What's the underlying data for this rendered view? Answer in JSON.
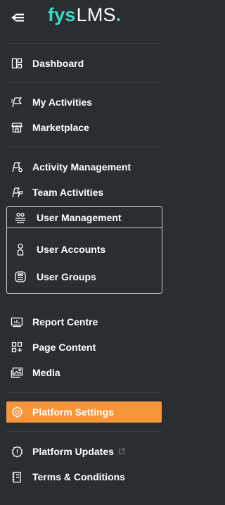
{
  "brand": {
    "part1": "fys",
    "part2": "LMS",
    "dot": "."
  },
  "colors": {
    "background": "#2a2d32",
    "brand_accent": "#3ed8c3",
    "active": "#f7953b",
    "divider": "#3d4148"
  },
  "nav": {
    "dashboard": "Dashboard",
    "my_activities": "My Activities",
    "marketplace": "Marketplace",
    "activity_management": "Activity Management",
    "team_activities": "Team Activities",
    "user_management": "User Management",
    "user_accounts": "User Accounts",
    "user_groups": "User Groups",
    "report_centre": "Report Centre",
    "page_content": "Page Content",
    "media": "Media",
    "platform_settings": "Platform Settings",
    "platform_updates": "Platform Updates",
    "terms": "Terms & Conditions"
  },
  "icons": {
    "collapse": "collapse-menu-icon",
    "dashboard": "dashboard-icon",
    "my_activities": "flag-icon",
    "marketplace": "store-icon",
    "activity_management": "activity-manage-icon",
    "team_activities": "team-flag-icon",
    "user_management": "users-management-icon",
    "user_accounts": "person-icon",
    "user_groups": "group-icon",
    "report_centre": "report-icon",
    "page_content": "page-content-icon",
    "media": "media-icon",
    "platform_settings": "gear-icon",
    "platform_updates": "update-badge-icon",
    "terms": "document-icon",
    "external": "external-link-icon"
  }
}
